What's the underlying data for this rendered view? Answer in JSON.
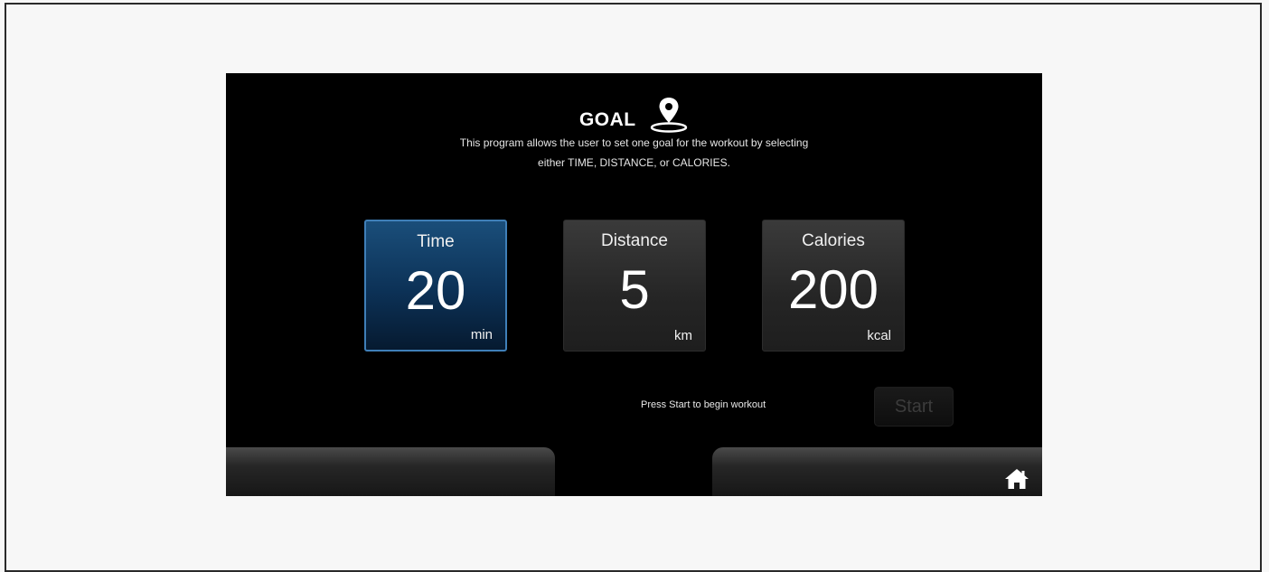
{
  "header": {
    "title": "GOAL",
    "icon": "location-pin-icon"
  },
  "description": {
    "line1": "This program allows the user to set one goal for the workout by selecting",
    "line2": "either TIME, DISTANCE, or CALORIES."
  },
  "goals": [
    {
      "label": "Time",
      "value": "20",
      "unit": "min",
      "selected": true
    },
    {
      "label": "Distance",
      "value": "5",
      "unit": "km",
      "selected": false
    },
    {
      "label": "Calories",
      "value": "200",
      "unit": "kcal",
      "selected": false
    }
  ],
  "footer": {
    "start_hint": "Press Start to begin workout",
    "start_label": "Start",
    "home_icon": "home-icon"
  },
  "colors": {
    "screen_bg": "#000000",
    "selected_tile": "#0c3156",
    "selected_border": "#3f7fb8",
    "inactive_tile": "#2a2a2a"
  }
}
